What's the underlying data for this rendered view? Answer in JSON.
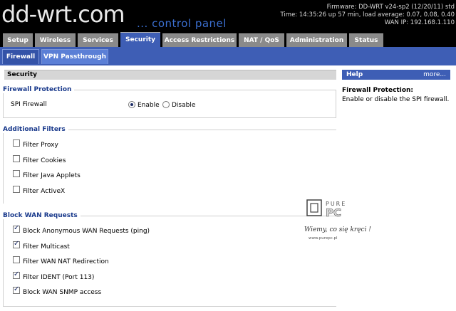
{
  "header": {
    "logo": "dd-wrt.com",
    "subtitle": "... control panel",
    "firmware": "Firmware: DD-WRT v24-sp2 (12/20/11) std",
    "time": "Time: 14:35:26 up 57 min, load average: 0.07, 0.08, 0.40",
    "wan_ip": "WAN IP: 192.168.1.110"
  },
  "tabs": [
    "Setup",
    "Wireless",
    "Services",
    "Security",
    "Access Restrictions",
    "NAT / QoS",
    "Administration",
    "Status"
  ],
  "subtabs": [
    "Firewall",
    "VPN Passthrough"
  ],
  "section_title": "Security",
  "firewall": {
    "legend": "Firewall Protection",
    "spi_label": "SPI Firewall",
    "enable": "Enable",
    "disable": "Disable",
    "selected": "Enable"
  },
  "filters": {
    "legend": "Additional Filters",
    "items": [
      {
        "label": "Filter Proxy",
        "checked": false
      },
      {
        "label": "Filter Cookies",
        "checked": false
      },
      {
        "label": "Filter Java Applets",
        "checked": false
      },
      {
        "label": "Filter ActiveX",
        "checked": false
      }
    ]
  },
  "wan": {
    "legend": "Block WAN Requests",
    "items": [
      {
        "label": "Block Anonymous WAN Requests (ping)",
        "checked": true
      },
      {
        "label": "Filter Multicast",
        "checked": true
      },
      {
        "label": "Filter WAN NAT Redirection",
        "checked": false
      },
      {
        "label": "Filter IDENT (Port 113)",
        "checked": true
      },
      {
        "label": "Block WAN SNMP access",
        "checked": true
      }
    ]
  },
  "help": {
    "title": "Help",
    "more": "more...",
    "heading": "Firewall Protection:",
    "text": "Enable or disable the SPI firewall."
  },
  "watermark": {
    "brand_top": "PURE",
    "brand_bottom": "PC",
    "slogan": "Wiemy, co się kręci !",
    "site": "www.purepc.pl"
  },
  "colors": {
    "accent": "#3e5eb5",
    "legend": "#1a3a8c",
    "tab_inactive": "#8a8a8a"
  }
}
